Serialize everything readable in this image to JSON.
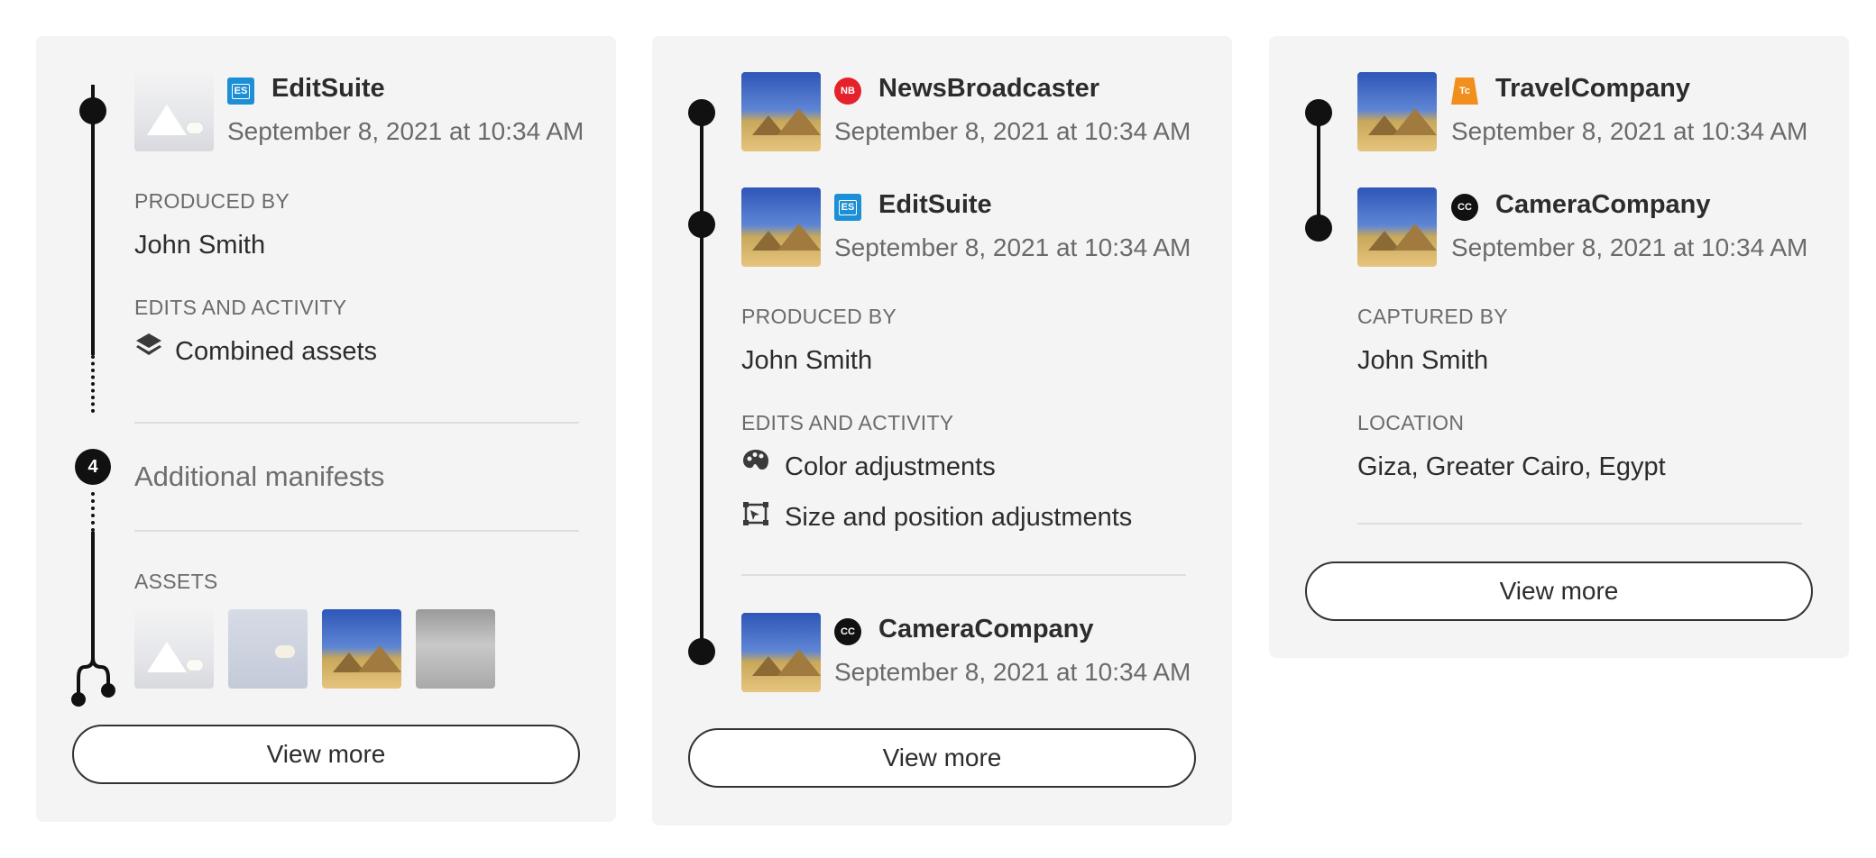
{
  "cards": [
    {
      "entries": [
        {
          "app": "EditSuite",
          "app_icon": "editsuite-icon",
          "icon_text": "ES",
          "date": "September 8, 2021 at 10:34 AM"
        }
      ],
      "sections": [
        {
          "label": "PRODUCED BY",
          "value": "John Smith"
        },
        {
          "label": "EDITS AND ACTIVITY",
          "activities": [
            {
              "icon": "layers-icon",
              "text": "Combined assets"
            }
          ]
        }
      ],
      "additional_manifests": {
        "count": "4",
        "label": "Additional manifests"
      },
      "assets": {
        "label": "ASSETS",
        "thumbnails": [
          "snowy-mountains",
          "polar-bear",
          "pyramids",
          "foggy-landscape"
        ]
      },
      "button": "View more"
    },
    {
      "entries": [
        {
          "app": "NewsBroadcaster",
          "app_icon": "newsbroadcaster-icon",
          "icon_text": "NB",
          "date": "September 8, 2021 at 10:34 AM"
        },
        {
          "app": "EditSuite",
          "app_icon": "editsuite-icon",
          "icon_text": "ES",
          "date": "September 8, 2021 at 10:34 AM"
        }
      ],
      "sections": [
        {
          "label": "PRODUCED BY",
          "value": "John Smith"
        },
        {
          "label": "EDITS AND ACTIVITY",
          "activities": [
            {
              "icon": "palette-icon",
              "text": "Color adjustments"
            },
            {
              "icon": "transform-icon",
              "text": "Size and position adjustments"
            }
          ]
        }
      ],
      "ingredient": {
        "app": "CameraCompany",
        "app_icon": "cameracompany-icon",
        "icon_text": "CC",
        "date": "September 8, 2021 at 10:34 AM"
      },
      "button": "View more"
    },
    {
      "entries": [
        {
          "app": "TravelCompany",
          "app_icon": "travelcompany-icon",
          "icon_text": "Tc",
          "date": "September 8, 2021 at 10:34 AM"
        },
        {
          "app": "CameraCompany",
          "app_icon": "cameracompany-icon",
          "icon_text": "CC",
          "date": "September 8, 2021 at 10:34 AM"
        }
      ],
      "sections": [
        {
          "label": "CAPTURED BY",
          "value": "John Smith"
        },
        {
          "label": "LOCATION",
          "value": "Giza, Greater Cairo, Egypt"
        }
      ],
      "button": "View more"
    }
  ]
}
